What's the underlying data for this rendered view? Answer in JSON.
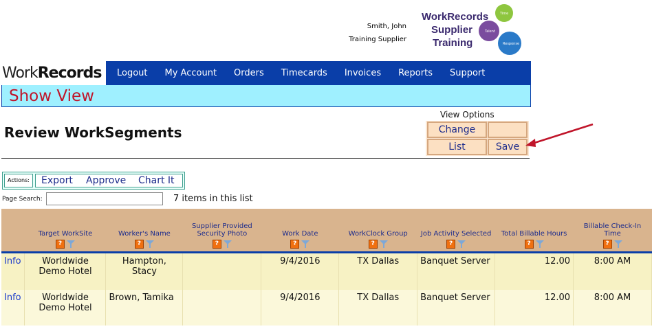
{
  "user": {
    "name": "Smith, John",
    "company": "Training Supplier"
  },
  "badge": {
    "line1": "WorkRecords",
    "line2": "Supplier",
    "line3": "Training",
    "gear1": "Time",
    "gear2": "Talent",
    "gear3": "Response"
  },
  "brand": {
    "part1": "Work",
    "part2": "Records"
  },
  "nav": [
    {
      "label": "Logout"
    },
    {
      "label": "My Account"
    },
    {
      "label": "Orders"
    },
    {
      "label": "Timecards"
    },
    {
      "label": "Invoices"
    },
    {
      "label": "Reports"
    },
    {
      "label": "Support"
    }
  ],
  "show_view": "Show View",
  "page_title": "Review WorkSegments",
  "view_options": {
    "title": "View Options",
    "change": "Change",
    "list": "List",
    "save": "Save"
  },
  "actions": {
    "label": "Actions:",
    "export": "Export",
    "approve": "Approve",
    "chart": "Chart It"
  },
  "search": {
    "label": "Page Search:",
    "value": ""
  },
  "item_count": "7 items in this list",
  "columns": [
    "",
    "Target WorkSite",
    "Worker's Name",
    "Supplier Provided Security Photo",
    "Work Date",
    "WorkClock Group",
    "Job Activity Selected",
    "Total Billable Hours",
    "Billable Check-In Time"
  ],
  "rows": [
    {
      "info": "Info",
      "site": "Worldwide Demo Hotel",
      "worker": "Hampton, Stacy",
      "photo": "",
      "date": "9/4/2016",
      "group": "TX Dallas",
      "activity": "Banquet Server",
      "hours": "12.00",
      "checkin": "8:00 AM"
    },
    {
      "info": "Info",
      "site": "Worldwide Demo Hotel",
      "worker": "Brown, Tamika",
      "photo": "",
      "date": "9/4/2016",
      "group": "TX Dallas",
      "activity": "Banquet Server",
      "hours": "12.00",
      "checkin": "8:00 AM"
    }
  ],
  "colors": {
    "nav": "#0a3ea8",
    "showview_bg": "#9ff0ff",
    "showview_text": "#c0152a",
    "header_bg": "#d9b48e",
    "row_bg": "#f7f2c4",
    "arrow": "#c0152a"
  }
}
